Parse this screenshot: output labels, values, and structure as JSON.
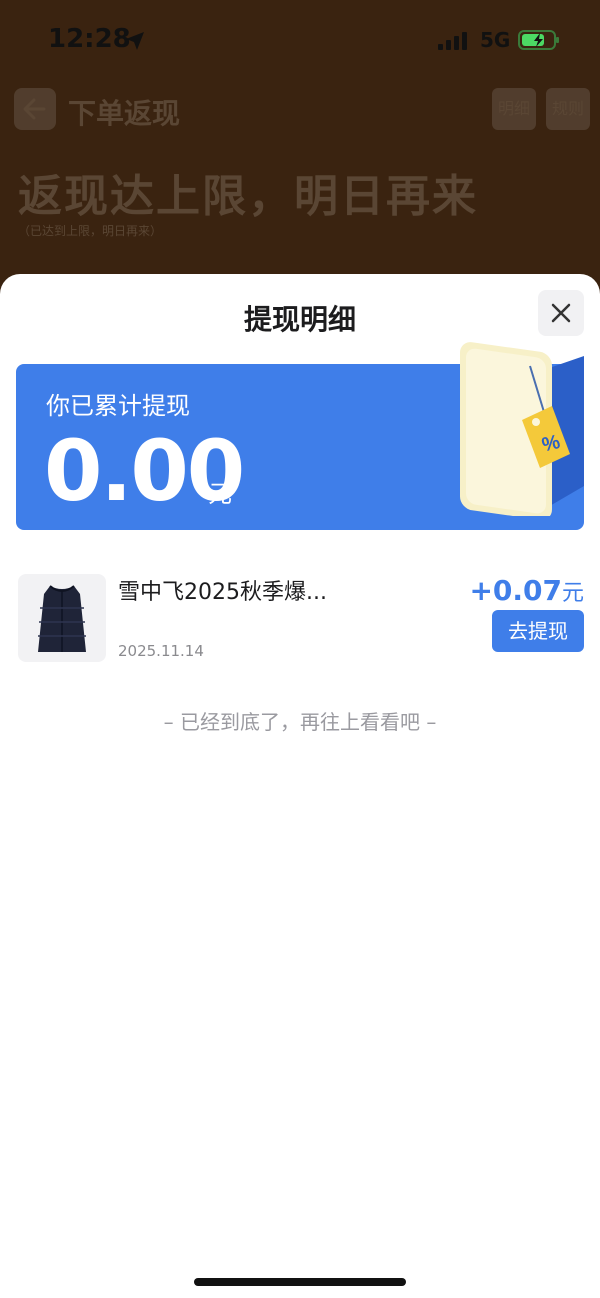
{
  "status": {
    "time": "12:28",
    "network": "5G"
  },
  "background_page": {
    "title": "下单返现",
    "detail_btn": "明细",
    "rule_btn": "规则",
    "headline": "返现达上限，明日再来",
    "subtext": "（已达到上限，明日再来）"
  },
  "sheet": {
    "title": "提现明细",
    "banner": {
      "label": "你已累计提现",
      "amount": "0.00",
      "unit": "元"
    },
    "items": [
      {
        "title": "雪中飞2025秋季爆...",
        "date": "2025.11.14",
        "amount": "+0.07",
        "unit": "元",
        "button": "去提现"
      }
    ],
    "end_note": "– 已经到底了，再往上看看吧 –"
  },
  "colors": {
    "accent": "#3f7ee9",
    "tag_yellow": "#f4c93a"
  },
  "icons": [
    "location-arrow-icon",
    "signal-icon",
    "battery-icon",
    "back-arrow-icon",
    "close-icon",
    "wallet-tag-illustration",
    "vest-product-image"
  ]
}
